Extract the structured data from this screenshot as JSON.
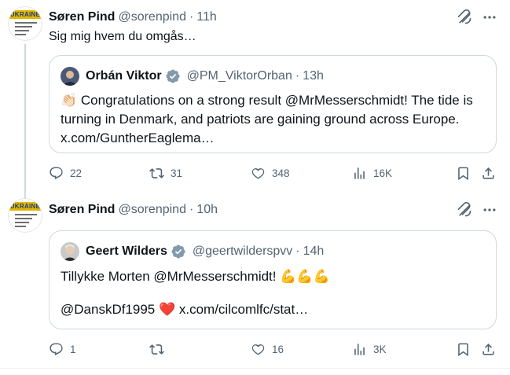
{
  "tweets": [
    {
      "author_name": "Søren Pind",
      "author_handle": "@sorenpind",
      "separator": "·",
      "time": "11h",
      "avatar_text": "UKRAINE",
      "text": "Sig mig hvem du omgås…",
      "quote": {
        "author_name": "Orbán Viktor",
        "author_handle": "@PM_ViktorOrban",
        "separator": "·",
        "time": "13h",
        "line1_emoji": "👏🏻",
        "line1": "Congratulations on a strong result @MrMesserschmidt! The tide is",
        "line2": "turning in Denmark, and patriots are gaining ground across Europe.",
        "line3": "x.com/GuntherEaglema…"
      },
      "stats": {
        "replies": "22",
        "reposts": "31",
        "likes": "348",
        "views": "16K"
      }
    },
    {
      "author_name": "Søren Pind",
      "author_handle": "@sorenpind",
      "separator": "·",
      "time": "10h",
      "avatar_text": "UKRAINE",
      "quote": {
        "author_name": "Geert Wilders",
        "author_handle": "@geertwilderspvv",
        "separator": "·",
        "time": "14h",
        "line1": "Tillykke Morten @MrMesserschmidt! 💪💪💪",
        "line2": "@DanskDf1995 ❤️ x.com/cilcomlfc/stat…"
      },
      "stats": {
        "replies": "1",
        "reposts": "",
        "likes": "16",
        "views": "3K"
      }
    }
  ],
  "colors": {
    "text_primary": "#0f1419",
    "text_secondary": "#536471",
    "border": "#cfd9de",
    "verified_badge": "#829aab"
  },
  "icons": [
    "grok-icon",
    "more-icon",
    "reply-icon",
    "repost-icon",
    "like-icon",
    "views-icon",
    "bookmark-icon",
    "share-icon",
    "verified-badge-icon"
  ]
}
